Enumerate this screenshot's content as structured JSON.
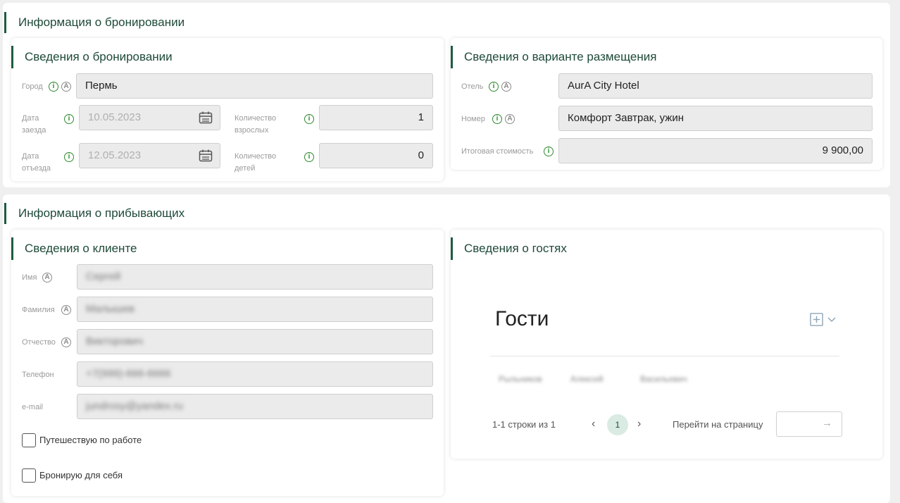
{
  "booking_section": {
    "title": "Информация о бронировании",
    "booking_card": {
      "title": "Сведения о бронировании",
      "city_label": "Город",
      "city_value": "Пермь",
      "checkin_label": "Дата заезда",
      "checkin_value": "10.05.2023",
      "checkout_label": "Дата отъезда",
      "checkout_value": "12.05.2023",
      "adults_label": "Количество взрослых",
      "adults_value": "1",
      "children_label": "Количество детей",
      "children_value": "0"
    },
    "accommodation_card": {
      "title": "Сведения о варианте размещения",
      "hotel_label": "Отель",
      "hotel_value": "AurA City Hotel",
      "room_label": "Номер",
      "room_value": "Комфорт Завтрак, ужин",
      "total_label": "Итоговая стоимость",
      "total_value": "9 900,00"
    }
  },
  "arrivals_section": {
    "title": "Информация о прибывающих",
    "client_card": {
      "title": "Сведения о клиенте",
      "first_name_label": "Имя",
      "first_name_value": "Сергей",
      "last_name_label": "Фамилия",
      "last_name_value": "Малышев",
      "patronymic_label": "Отчество",
      "patronymic_value": "Викторович",
      "phone_label": "Телефон",
      "phone_value": "+7(999)-666-6666",
      "email_label": "e-mail",
      "email_value": "jundrosy@yandex.ru",
      "business_trip_label": "Путешествую по работе",
      "business_trip_checked": false,
      "book_for_self_label": "Бронирую для себя",
      "book_for_self_checked": false
    },
    "guests_card": {
      "title": "Сведения о гостях",
      "heading": "Гости",
      "guest_row": [
        "Рыльников",
        "Алексей",
        "Васильевич"
      ],
      "rows_info": "1-1 строки из 1",
      "current_page": "1",
      "goto_label": "Перейти на страницу"
    }
  },
  "icons": {
    "info": "info-icon",
    "auto": "auto-icon",
    "calendar": "calendar-icon",
    "add": "add-icon",
    "chevron": "chevron-down-icon",
    "arrow_right": "arrow-right-icon"
  },
  "colors": {
    "accent": "#1e5c3f",
    "info": "#2e8b2e",
    "page_active_bg": "#d9ebe2"
  }
}
